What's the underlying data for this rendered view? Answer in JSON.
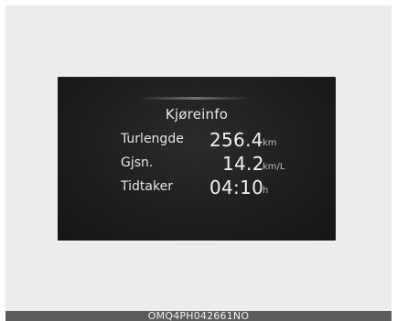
{
  "display": {
    "title": "Kjøreinfo",
    "rows": [
      {
        "label": "Turlengde",
        "value": "256.4",
        "unit": "km"
      },
      {
        "label": "Gjsn.",
        "value": "14.2",
        "unit": "km/L"
      },
      {
        "label": "Tidtaker",
        "value": "04:10",
        "unit": "h"
      }
    ]
  },
  "footer": {
    "code": "OMQ4PH042661NO"
  },
  "colors": {
    "screen_background": "#201e1d",
    "text": "#e6e6e6",
    "page_panel": "#ececec",
    "footer_bar": "#5c5c5c"
  }
}
